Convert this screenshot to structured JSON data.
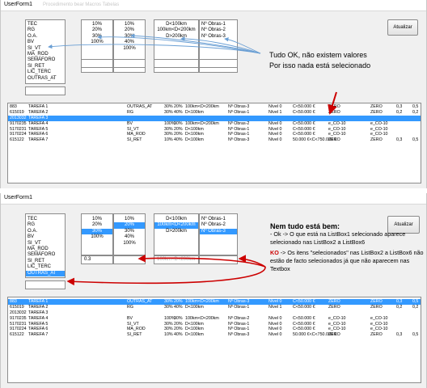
{
  "window1": {
    "title": "UserForm1",
    "title_extra": "Procedimento  bear  Macros  Tabelas",
    "update_button": "Atualizar",
    "listbox1": [
      "TEC",
      "RG",
      "O.A.",
      "BV",
      "SI_VT",
      "MA_ROD",
      "SEMÁFORO",
      "SI_RET",
      "LIC_TERC",
      "OUTRAS_AT"
    ],
    "listbox2": [
      "10%",
      "20%",
      "30%",
      "100%"
    ],
    "listbox3": [
      "10%",
      "20%",
      "30%",
      "40%",
      "100%"
    ],
    "listbox4": [
      "D<100km",
      "100km<D<200km",
      "D>200km"
    ],
    "listbox5": [
      "Nº Obras-1",
      "Nº Obras-2",
      "Nº Obras-3"
    ],
    "annotation": [
      "Tudo OK, não existem valores",
      "Por isso nada está selecionado"
    ],
    "rows": [
      [
        "883",
        "TAREFA 1",
        "OUTRAS_AT",
        "30%",
        "20%",
        "100km<D<200km",
        "Nº Obras-3",
        "Nível 0",
        "C<50.000 €",
        "ZERO",
        "ZERO",
        "0,3",
        "0,5"
      ],
      [
        "615019",
        "TAREFA 2",
        "RG",
        "30%",
        "40%",
        "D<100km",
        "Nº Obras-1",
        "Nível 1",
        "C<50.000 €",
        "ZERO",
        "ZERO",
        "0,2",
        "0,2"
      ],
      [
        "2013032",
        "TAREFA 3",
        "",
        "",
        "",
        "",
        "",
        "",
        "",
        "",
        "",
        "",
        ""
      ],
      [
        "9170235",
        "TAREFA 4",
        "BV",
        "100%",
        "30%",
        "100km<D<200km",
        "Nº Obras-2",
        "Nível 0",
        "C<50.000 €",
        "e_CO-10",
        "e_CO-10",
        "",
        ""
      ],
      [
        "5170231",
        "TAREFA 5",
        "SI_VT",
        "30%",
        "20%",
        "D<100km",
        "Nº Obras-1",
        "Nível 0",
        "C<50.000 €",
        "e_CO-10",
        "e_CO-10",
        "",
        ""
      ],
      [
        "9170224",
        "TAREFA 6",
        "MA_ROD",
        "30%",
        "20%",
        "D<100km",
        "Nº Obras-1",
        "Nível 0",
        "C<50.000 €",
        "e_CO-10",
        "e_CO-10",
        "",
        ""
      ],
      [
        "615122",
        "TAREFA 7",
        "SI_RET",
        "10%",
        "40%",
        "D<100km",
        "Nº Obras-3",
        "Nível 0",
        "50.000 €<C<750.000 €",
        "ZERO",
        "ZERO",
        "0,3",
        "0,5"
      ]
    ],
    "selected_row": 2
  },
  "window2": {
    "title": "UserForm1",
    "update_button": "Atualizar",
    "listbox1": [
      "TEC",
      "RG",
      "O.A.",
      "BV",
      "SI_VT",
      "MA_ROD",
      "SEMÁFORO",
      "SI_RET",
      "LIC_TERC",
      "OUTRAS_AT"
    ],
    "listbox1_selected": 9,
    "listbox2": [
      "10%",
      "20%",
      "30%",
      "100%"
    ],
    "listbox2_selected": 2,
    "listbox3": [
      "10%",
      "20%",
      "30%",
      "40%",
      "100%"
    ],
    "listbox3_selected": 1,
    "listbox4": [
      "D<100km",
      "100km<D<200km",
      "D>200km"
    ],
    "listbox4_selected": 1,
    "listbox5": [
      "Nº Obras-1",
      "Nº Obras-2",
      "Nº Obras-3"
    ],
    "listbox5_selected": 2,
    "textbox2": "0.3",
    "textbox4": "100km<D<200km",
    "annotation_title": "Nem tudo está bem:",
    "annotation_ok": " - Ok -> O que está na ListBox1 selecionado aparece selecionado nas ListBox2 a ListBox6",
    "annotation_ko_label": "KO",
    "annotation_ko": " -> Os itens \"selecionados\" nas ListBox2 a ListBox6 não estão de facto selecionados já que não aparecem nas Textbox",
    "rows": [
      [
        "883",
        "TAREFA 1",
        "OUTRAS_AT",
        "30%",
        "20%",
        "100km<D<200km",
        "Nº Obras-3",
        "Nível 0",
        "C<50.000 €",
        "ZERO",
        "ZERO",
        "0,3",
        "0,5"
      ],
      [
        "615019",
        "TAREFA 2",
        "RG",
        "30%",
        "40%",
        "D<100km",
        "Nº Obras-1",
        "Nível 1",
        "C<50.000 €",
        "ZERO",
        "ZERO",
        "0,2",
        "0,2"
      ],
      [
        "2013032",
        "TAREFA 3",
        "",
        "",
        "",
        "",
        "",
        "",
        "",
        "",
        "",
        "",
        ""
      ],
      [
        "9170235",
        "TAREFA 4",
        "BV",
        "100%",
        "30%",
        "100km<D<200km",
        "Nº Obras-2",
        "Nível 0",
        "C<50.000 €",
        "e_CO-10",
        "e_CO-10",
        "",
        ""
      ],
      [
        "5170231",
        "TAREFA 5",
        "SI_VT",
        "30%",
        "20%",
        "D<100km",
        "Nº Obras-1",
        "Nível 0",
        "C<50.000 €",
        "e_CO-10",
        "e_CO-10",
        "",
        ""
      ],
      [
        "9170224",
        "TAREFA 6",
        "MA_ROD",
        "30%",
        "20%",
        "D<100km",
        "Nº Obras-1",
        "Nível 0",
        "C<50.000 €",
        "e_CO-10",
        "e_CO-10",
        "",
        ""
      ],
      [
        "615122",
        "TAREFA 7",
        "SI_RET",
        "10%",
        "40%",
        "D<100km",
        "Nº Obras-3",
        "Nível 0",
        "50.000 €<C<750.000 €",
        "ZERO",
        "ZERO",
        "0,3",
        "0,5"
      ]
    ],
    "selected_row": 0
  },
  "colors": {
    "selection": "#3399ff",
    "arrow_blue": "#6a9fd4",
    "arrow_red": "#cc0000"
  }
}
